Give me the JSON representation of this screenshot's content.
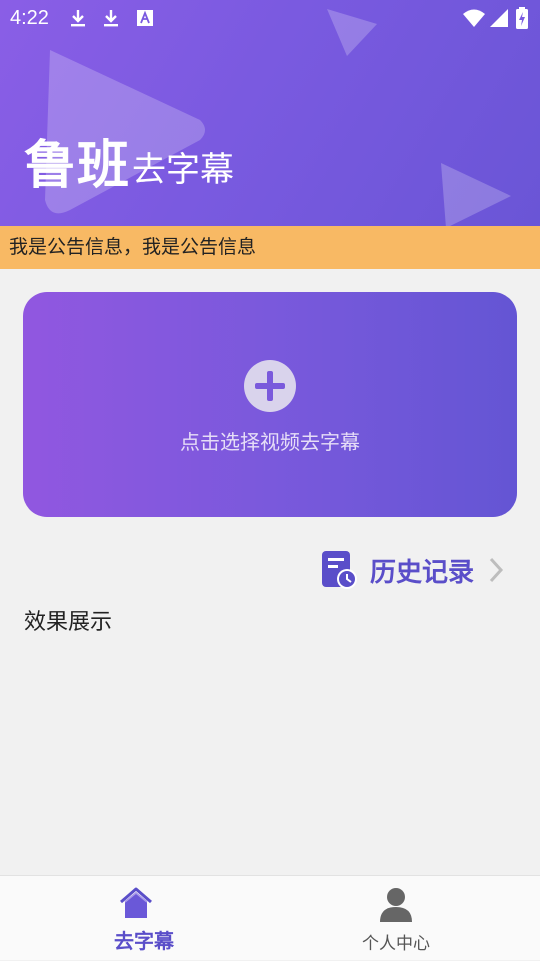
{
  "status_bar": {
    "time": "4:22",
    "icons": [
      "download-icon",
      "download-icon",
      "text-a-icon",
      "wifi-icon",
      "signal-icon",
      "battery-charging-icon"
    ]
  },
  "header": {
    "brand_main": "鲁班",
    "brand_sub": "去字幕"
  },
  "notice": {
    "text": "我是公告信息，我是公告信息"
  },
  "upload": {
    "icon": "plus-circle-icon",
    "label": "点击选择视频去字幕"
  },
  "history": {
    "icon": "history-clock-icon",
    "label": "历史记录",
    "chevron_icon": "chevron-right-icon"
  },
  "effect": {
    "title": "效果展示"
  },
  "bottom_nav": {
    "items": [
      {
        "label": "去字幕",
        "icon": "home-icon",
        "active": true
      },
      {
        "label": "个人中心",
        "icon": "person-icon",
        "active": false
      }
    ]
  },
  "colors": {
    "accent": "#5a4ec9",
    "header_gradient_start": "#8a5ee6",
    "header_gradient_end": "#6a55d6",
    "notice_bg": "#f8b964",
    "page_bg": "#f1f1f1"
  }
}
